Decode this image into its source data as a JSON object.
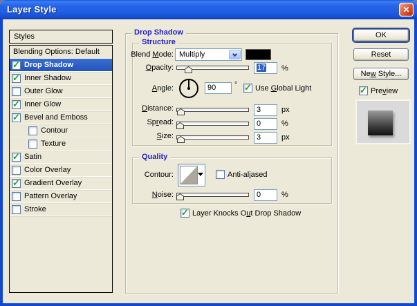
{
  "window": {
    "title": "Layer Style"
  },
  "glyphs": {
    "check": "✓",
    "close": "✕"
  },
  "colors": {
    "titlebar_blue": "#2563e8",
    "selection_blue": "#2b5ec4",
    "section_label_blue": "#2222cc",
    "check_green": "#1fa11f",
    "blend_swatch": "#000000",
    "dialog_bg": "#ece9d8"
  },
  "styles_panel": {
    "header": "Styles",
    "items": [
      {
        "label": "Blending Options: Default",
        "has_checkbox": false,
        "checked": false,
        "selected": false,
        "indent": false
      },
      {
        "label": "Drop Shadow",
        "has_checkbox": true,
        "checked": true,
        "selected": true,
        "indent": false
      },
      {
        "label": "Inner Shadow",
        "has_checkbox": true,
        "checked": true,
        "selected": false,
        "indent": false
      },
      {
        "label": "Outer Glow",
        "has_checkbox": true,
        "checked": false,
        "selected": false,
        "indent": false
      },
      {
        "label": "Inner Glow",
        "has_checkbox": true,
        "checked": true,
        "selected": false,
        "indent": false
      },
      {
        "label": "Bevel and Emboss",
        "has_checkbox": true,
        "checked": true,
        "selected": false,
        "indent": false
      },
      {
        "label": "Contour",
        "has_checkbox": true,
        "checked": false,
        "selected": false,
        "indent": true
      },
      {
        "label": "Texture",
        "has_checkbox": true,
        "checked": false,
        "selected": false,
        "indent": true
      },
      {
        "label": "Satin",
        "has_checkbox": true,
        "checked": true,
        "selected": false,
        "indent": false
      },
      {
        "label": "Color Overlay",
        "has_checkbox": true,
        "checked": false,
        "selected": false,
        "indent": false
      },
      {
        "label": "Gradient Overlay",
        "has_checkbox": true,
        "checked": true,
        "selected": false,
        "indent": false
      },
      {
        "label": "Pattern Overlay",
        "has_checkbox": true,
        "checked": false,
        "selected": false,
        "indent": false
      },
      {
        "label": "Stroke",
        "has_checkbox": true,
        "checked": false,
        "selected": false,
        "indent": false
      }
    ]
  },
  "panel": {
    "title": "Drop Shadow",
    "structure": {
      "title": "Structure",
      "blend_mode": {
        "label": {
          "pre": "Blend ",
          "u": "M",
          "post": "ode:"
        },
        "value": "Multiply",
        "swatch_color": "#000000"
      },
      "opacity": {
        "label": {
          "pre": "",
          "u": "O",
          "post": "pacity:"
        },
        "value": "17",
        "unit": "%",
        "selected": true,
        "percent": 17
      },
      "angle": {
        "label": {
          "pre": "",
          "u": "A",
          "post": "ngle:"
        },
        "value": "90",
        "unit": "°"
      },
      "use_global_light": {
        "label": {
          "pre": "Use ",
          "u": "G",
          "post": "lobal Light"
        },
        "checked": true
      },
      "distance": {
        "label": {
          "pre": "",
          "u": "D",
          "post": "istance:"
        },
        "value": "3",
        "unit": "px",
        "percent": 1
      },
      "spread": {
        "label": {
          "pre": "Sp",
          "u": "r",
          "post": "ead:"
        },
        "value": "0",
        "unit": "%",
        "percent": 0
      },
      "size": {
        "label": {
          "pre": "",
          "u": "S",
          "post": "ize:"
        },
        "value": "3",
        "unit": "px",
        "percent": 1
      }
    },
    "quality": {
      "title": "Quality",
      "contour": {
        "label": {
          "pre": "Contour:",
          "u": "",
          "post": ""
        }
      },
      "anti_aliased": {
        "label": {
          "pre": "Anti-al",
          "u": "i",
          "post": "ased"
        },
        "checked": false
      },
      "noise": {
        "label": {
          "pre": "",
          "u": "N",
          "post": "oise:"
        },
        "value": "0",
        "unit": "%",
        "percent": 0
      }
    },
    "knockout": {
      "label": {
        "pre": "Layer Knocks O",
        "u": "u",
        "post": "t Drop Shadow"
      },
      "checked": true
    }
  },
  "actions": {
    "ok": "OK",
    "reset": "Reset",
    "new_style": {
      "pre": "Ne",
      "u": "w",
      "post": " Style..."
    },
    "preview": {
      "label": {
        "pre": "Pre",
        "u": "v",
        "post": "iew"
      },
      "checked": true
    }
  }
}
